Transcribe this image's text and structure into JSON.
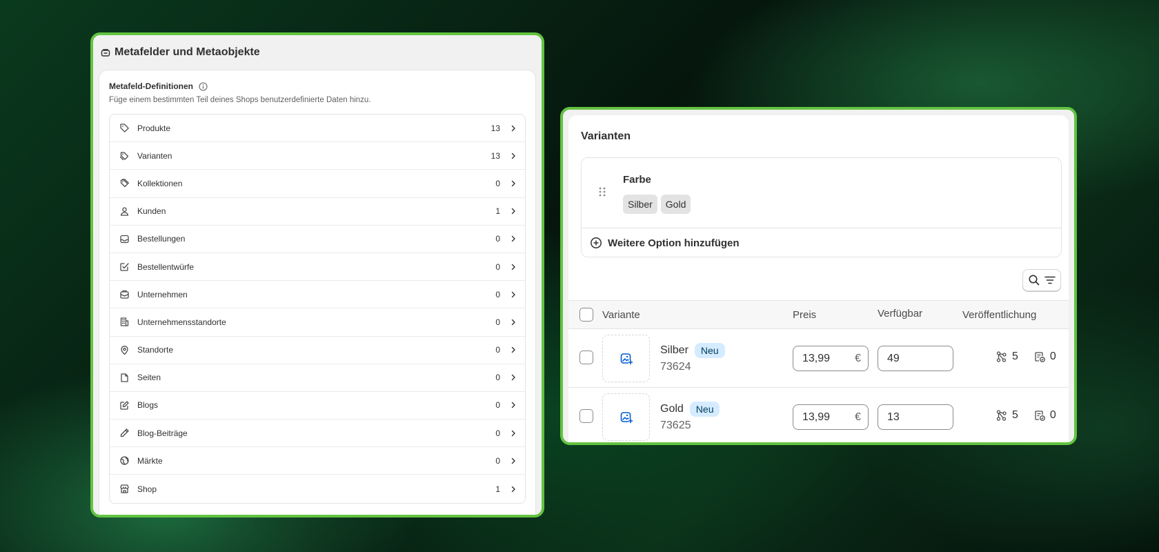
{
  "metafields": {
    "title": "Metafelder und Metaobjekte",
    "section_title": "Metafeld-Definitionen",
    "description": "Füge einem bestimmten Teil deines Shops benutzerdefinierte Daten hinzu.",
    "items": [
      {
        "label": "Produkte",
        "count": "13",
        "icon": "tag-icon"
      },
      {
        "label": "Varianten",
        "count": "13",
        "icon": "variant-tag-icon"
      },
      {
        "label": "Kollektionen",
        "count": "0",
        "icon": "collection-icon"
      },
      {
        "label": "Kunden",
        "count": "1",
        "icon": "person-icon"
      },
      {
        "label": "Bestellungen",
        "count": "0",
        "icon": "inbox-icon"
      },
      {
        "label": "Bestellentwürfe",
        "count": "0",
        "icon": "draft-order-icon"
      },
      {
        "label": "Unternehmen",
        "count": "0",
        "icon": "company-icon"
      },
      {
        "label": "Unternehmensstandorte",
        "count": "0",
        "icon": "building-icon"
      },
      {
        "label": "Standorte",
        "count": "0",
        "icon": "location-pin-icon"
      },
      {
        "label": "Seiten",
        "count": "0",
        "icon": "page-icon"
      },
      {
        "label": "Blogs",
        "count": "0",
        "icon": "blog-icon"
      },
      {
        "label": "Blog-Beiträge",
        "count": "0",
        "icon": "pencil-icon"
      },
      {
        "label": "Märkte",
        "count": "0",
        "icon": "globe-icon"
      },
      {
        "label": "Shop",
        "count": "1",
        "icon": "store-icon"
      }
    ]
  },
  "variants": {
    "title": "Varianten",
    "option": {
      "name": "Farbe",
      "values": [
        "Silber",
        "Gold"
      ]
    },
    "add_option_label": "Weitere Option hinzufügen",
    "columns": {
      "variant": "Variante",
      "price": "Preis",
      "available": "Verfügbar",
      "publishing": "Veröffentlichung"
    },
    "rows": [
      {
        "name": "Silber",
        "badge": "Neu",
        "sku": "73624",
        "price": "13,99",
        "currency": "€",
        "available": "49",
        "channels": "5",
        "catalogs": "0"
      },
      {
        "name": "Gold",
        "badge": "Neu",
        "sku": "73625",
        "price": "13,99",
        "currency": "€",
        "available": "13",
        "channels": "5",
        "catalogs": "0"
      }
    ]
  }
}
